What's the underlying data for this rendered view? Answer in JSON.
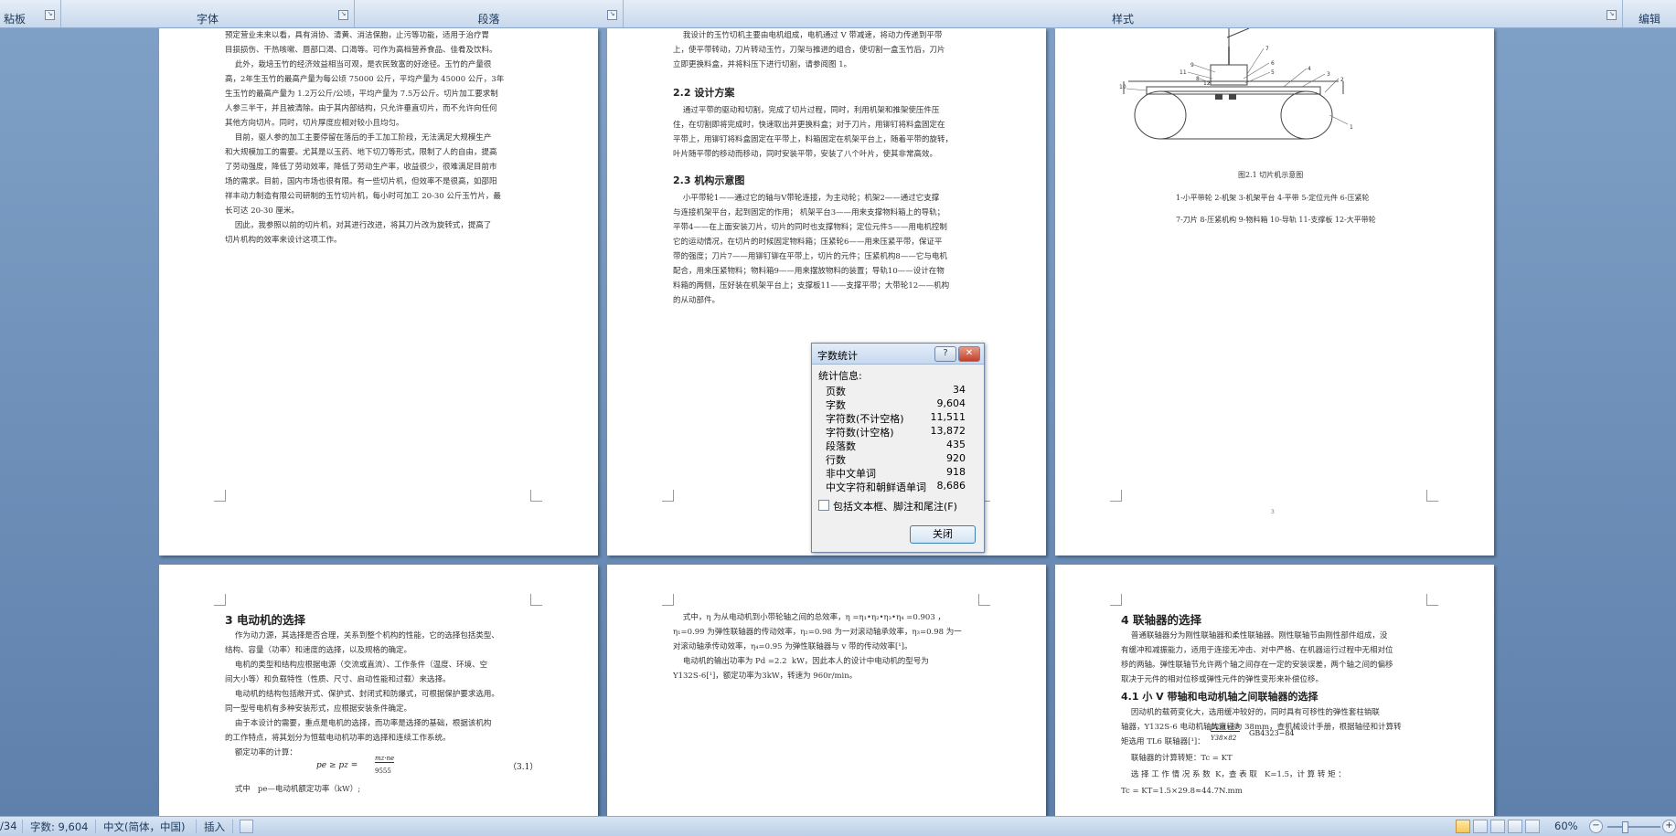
{
  "ribbon": {
    "groups": [
      "粘板",
      "字体",
      "段落",
      "样式",
      "编辑"
    ]
  },
  "pages": {
    "p1": {
      "paras": [
        "预定营业未来以看，具有消协、清黄、消洁保胞，止污等功能，适用于治疗胃",
        "目损损伤、干热咳嗽、唇部口渴、口渴等。可作为高档营养食品、佳肴及饮料。",
        "    此外，栽培玉竹的经济效益相当可观，是农民致富的好途径。玉竹的产量很",
        "高，2年生玉竹的最高产量为每公顷 75000 公斤，平均产量为 45000 公斤，3年",
        "生玉竹的最高产量为 1.2万公斤/公顷，平均产量为 7.5万公斤。切片加工要求制",
        "人参三半干，并且被清除。由于其内部结构，只允许垂直切片，而不允许向任何",
        "其他方向切片。同时，切片厚度应相对较小且均匀。",
        "    目前，驱人参的加工主要停留在落后的手工加工阶段，无法满足大规模生产",
        "和大规模加工的需要。尤其是以玉药、地下切刀等形式，限制了人的自由，提高",
        "了劳动强度，降低了劳动效率，降低了劳动生产率，收益很少，很难满足目前市",
        "场的需求。目前，国内市场也很有限。有一些切片机，但效率不是很高，如邵阳",
        "祥丰动力制造有限公司研制的玉竹切片机，每小时可加工 20-30 公斤玉竹片，最",
        "长可达 20-30 厘米。",
        "    因此，我参照以前的切片机，对其进行改进，将其刀片改为旋转式，提高了",
        "切片机构的效率来设计这项工作。"
      ]
    },
    "p2": {
      "intro": [
        "    我设计的玉竹切机主要由电机组成，电机通过 V 带减速，将动力传递到平带",
        "上，使平带转动，刀片转动玉竹，刀架与推进的组合，使切割一盒玉竹后，刀片",
        "立即更换料盒，并将料压下进行切割，请参阅图 1。"
      ],
      "h22": "2.2 设计方案",
      "p22": [
        "    通过平带的驱动和切割，完成了切片过程，同时，利用机架和推架使压件压",
        "住，在切割即将完成时，快速取出并更换料盒；对于刀片，用铆钉将料盒固定在",
        "平带上，用铆钉将料盒固定在平带上，料箱固定在机架平台上，随着平带的旋转，",
        "叶片随平带的移动而移动，同时安装平带，安装了八个叶片，使其非常高效。"
      ],
      "h23": "2.3 机构示意图",
      "p23": [
        "    小平带轮1——通过它的轴与V带轮连接，为主动轮；机架2——通过它支撑",
        "与连接机架平台，起到固定的作用； 机架平台3——用来支撑物料箱上的导轨；",
        "平带4——在上面安装刀片，切片的同时也支撑物料；定位元件5——用电机控制",
        "它的运动情况，在切片的时候固定物料箱；压紧轮6——用来压紧平带，保证平",
        "带的强度；刀片7——用铆钉铆在平带上，切片的元件；压紧机构8——它与电机",
        "配合，用来压紧物料；物料箱9——用来摆放物料的装置；导轨10——设计在物",
        "料箱的两侧，压好装在机架平台上；支撑板11——支撑平带；大带轮12——机构",
        "的从动部件。"
      ]
    },
    "p3": {
      "caption": "图2.1   切片机示意图",
      "legend1": "1-小平带轮  2-机架  3-机架平台  4-平带  5-定位元件  6-压紧轮",
      "legend2": "7-刀片  8-压紧机构  9-物料箱   10-导轨  11-支撑板   12-大平带轮",
      "labels": [
        "1",
        "2",
        "3",
        "4",
        "5",
        "6",
        "7",
        "8",
        "9",
        "10",
        "11",
        "12"
      ],
      "pagenum": "3"
    },
    "p4": {
      "heading": "3   电动机的选择",
      "paras": [
        "    作为动力源，其选择是否合理，关系到整个机构的性能，它的选择包括类型、",
        "结构、容量（功率）和速度的选择，以及规格的确定。",
        "    电机的类型和结构应根据电源（交流或直流）、工作条件（温度、环境、空",
        "间大小等）和负载特性（性质、尺寸、启动性能和过载）来选择。",
        "    电动机的结构包括敞开式、保护式、封闭式和防爆式，可根据保护要求选用。",
        "同一型号电机有多种安装形式，应根据安装条件确定。",
        "    由于本设计的需要，重点是电机的选择，而功率是选择的基础，根据该机构",
        "的工作特点，将其划分为恒载电动机功率的选择和连续工作系统。",
        "    额定功率的计算："
      ],
      "formula": "pe ≥ pz =",
      "frac_num": "mz·ne",
      "frac_den": "9555",
      "eqno": "（3.1）",
      "tail": "    式中   pe—电动机额定功率（kW）;"
    },
    "p5": {
      "paras": [
        "    式中，η 为从电动机到小带轮轴之间的总效率，η =η₁•η₂•η₃•η₄ =0.903 ，",
        "η₁=0.99 为弹性联轴器的传动效率，η₂=0.98 为一对滚动轴承效率，η₃=0.98 为一",
        "对滚动轴承传动效率，η₄=0.95 为弹性联轴器与 v 带的传动效率[¹]。",
        "    电动机的输出功率为 Pd =2.2  kW，因此本人的设计中电动机的型号为",
        "Y132S-6[¹]，额定功率为3kW，转速为 960r/min。"
      ]
    },
    "p6": {
      "heading": "4   联轴器的选择",
      "paras": [
        "    普通联轴器分为刚性联轴器和柔性联轴器。刚性联轴节由刚性部件组成，没",
        "有缓冲和减振能力，适用于连接无冲击、对中严格、在机器运行过程中无相对位",
        "移的两轴。弹性联轴节允许两个轴之间存在一定的安装误差，两个轴之间的偏移",
        "取决于元件的相对位移或弹性元件的弹性变形来补偿位移。"
      ],
      "h41": "4.1 小 V 带轴和电动机轴之间联轴器的选择",
      "p41": [
        "    因动机的载荷变化大，选用缓冲较好的，同时具有可移性的弹性套柱销联",
        "轴器，Y132S-6 电动机轴的直径为 38mm，查机械设计手册，根据轴径和计算转",
        "矩选用 TL6 联轴器[¹]："
      ],
      "coupling_num": "JA38×60",
      "coupling_den": "Y38×82",
      "coupling_std": "GB4323−84",
      "torque1": "    联轴器的计算转矩：Tc = KT",
      "torque2": "    选 择 工 作 情 况 系 数  K，查 表 取   K=1.5，计 算 转 矩 ：",
      "torque3": "Tc = KT=1.5×29.8≈44.7N.mm"
    }
  },
  "dialog": {
    "title": "字数统计",
    "section": "统计信息:",
    "stats": [
      {
        "label": "页数",
        "value": "34"
      },
      {
        "label": "字数",
        "value": "9,604"
      },
      {
        "label": "字符数(不计空格)",
        "value": "11,511"
      },
      {
        "label": "字符数(计空格)",
        "value": "13,872"
      },
      {
        "label": "段落数",
        "value": "435"
      },
      {
        "label": "行数",
        "value": "920"
      },
      {
        "label": "非中文单词",
        "value": "918"
      },
      {
        "label": "中文字符和朝鲜语单词",
        "value": "8,686"
      }
    ],
    "checkbox": "包括文本框、脚注和尾注(F)",
    "close": "关闭",
    "help_glyph": "?",
    "close_glyph": "✕"
  },
  "statusbar": {
    "page": "/34",
    "words": "字数: 9,604",
    "lang": "中文(简体，中国)",
    "mode": "插入",
    "zoom": "60%",
    "zoom_minus": "−",
    "zoom_plus": "+"
  }
}
